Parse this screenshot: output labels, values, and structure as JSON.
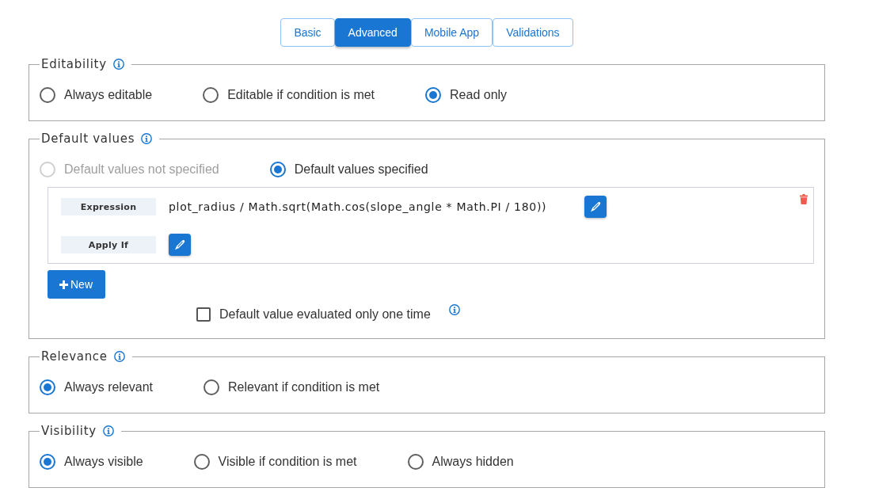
{
  "tabs": [
    {
      "label": "Basic",
      "selected": false
    },
    {
      "label": "Advanced",
      "selected": true
    },
    {
      "label": "Mobile App",
      "selected": false
    },
    {
      "label": "Validations",
      "selected": false
    }
  ],
  "sections": [
    {
      "kind": "choice",
      "title": "Editability",
      "options": [
        {
          "label": "Always editable",
          "selected": false,
          "disabled": false
        },
        {
          "label": "Editable if condition is met",
          "selected": false,
          "disabled": false
        },
        {
          "label": "Read only",
          "selected": true,
          "disabled": false
        }
      ]
    },
    {
      "kind": "default_values",
      "title": "Default values",
      "options": [
        {
          "label": "Default values not specified",
          "selected": false,
          "disabled": true
        },
        {
          "label": "Default values specified",
          "selected": true,
          "disabled": false
        }
      ],
      "entries": [
        {
          "fields": [
            {
              "label": "Expression",
              "value": "plot_radius / Math.sqrt(Math.cos(slope_angle * Math.PI / 180))"
            },
            {
              "label": "Apply If"
            }
          ]
        }
      ],
      "new_button": "New",
      "checkbox": {
        "label": "Default value evaluated only one time",
        "checked": false
      }
    },
    {
      "kind": "choice",
      "title": "Relevance",
      "options": [
        {
          "label": "Always relevant",
          "selected": true,
          "disabled": false
        },
        {
          "label": "Relevant if condition is met",
          "selected": false,
          "disabled": false
        }
      ]
    },
    {
      "kind": "choice",
      "title": "Visibility",
      "options": [
        {
          "label": "Always visible",
          "selected": true,
          "disabled": false
        },
        {
          "label": "Visible if condition is met",
          "selected": false,
          "disabled": false
        },
        {
          "label": "Always hidden",
          "selected": false,
          "disabled": false
        }
      ]
    }
  ]
}
